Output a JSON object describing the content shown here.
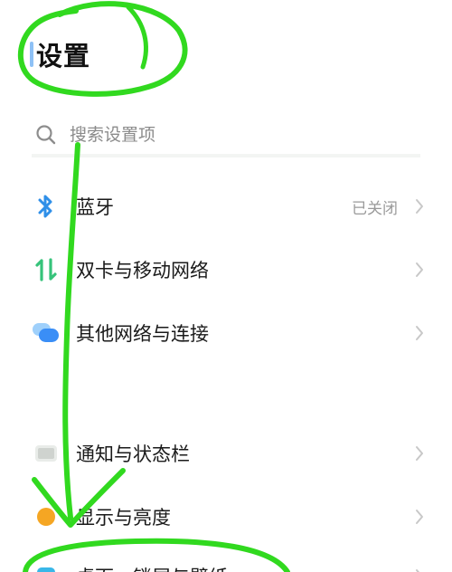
{
  "header": {
    "title": "设置"
  },
  "search": {
    "placeholder": "搜索设置项",
    "icon": "search-icon"
  },
  "settings": [
    {
      "label": "蓝牙",
      "status": "已关闭",
      "icon": "bluetooth-icon",
      "color": "#2f8fe8"
    },
    {
      "label": "双卡与移动网络",
      "status": "",
      "icon": "dual-sim-icon",
      "color": "#36c37a"
    },
    {
      "label": "其他网络与连接",
      "status": "",
      "icon": "network-connection-icon",
      "color": "#3a8ef6"
    },
    {
      "label": "通知与状态栏",
      "status": "",
      "icon": "notification-icon",
      "color": "#cfd3cf"
    },
    {
      "label": "显示与亮度",
      "status": "",
      "icon": "display-brightness-icon",
      "color": "#f5a623"
    },
    {
      "label": "桌面、锁屏与壁纸",
      "status": "",
      "icon": "desktop-wallpaper-icon",
      "color": "#39b7e8"
    }
  ],
  "colors": {
    "annotation": "#31d91f",
    "chevron": "#c8c8c8"
  }
}
